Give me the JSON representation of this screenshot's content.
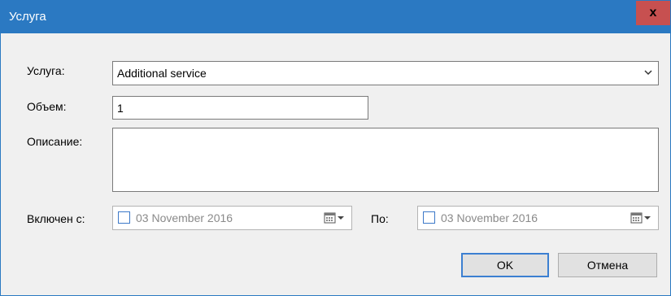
{
  "window": {
    "title": "Услуга",
    "close_symbol": "x"
  },
  "form": {
    "service_label": "Услуга:",
    "service_value": "Additional service",
    "volume_label": "Объем:",
    "volume_value": "1",
    "description_label": "Описание:",
    "description_value": "",
    "enabled_from_label": "Включен с:",
    "enabled_from_value": "03 November 2016",
    "to_label": "По:",
    "to_value": "03 November 2016"
  },
  "buttons": {
    "ok_label": "OK",
    "cancel_label": "Отмена"
  },
  "icons": {
    "combo": "chevron-down-icon",
    "calendar": "calendar-icon",
    "close": "close-icon"
  },
  "colors": {
    "titlebar": "#2b79c2",
    "close_button": "#c75050",
    "default_button_border": "#3c7fd1"
  }
}
